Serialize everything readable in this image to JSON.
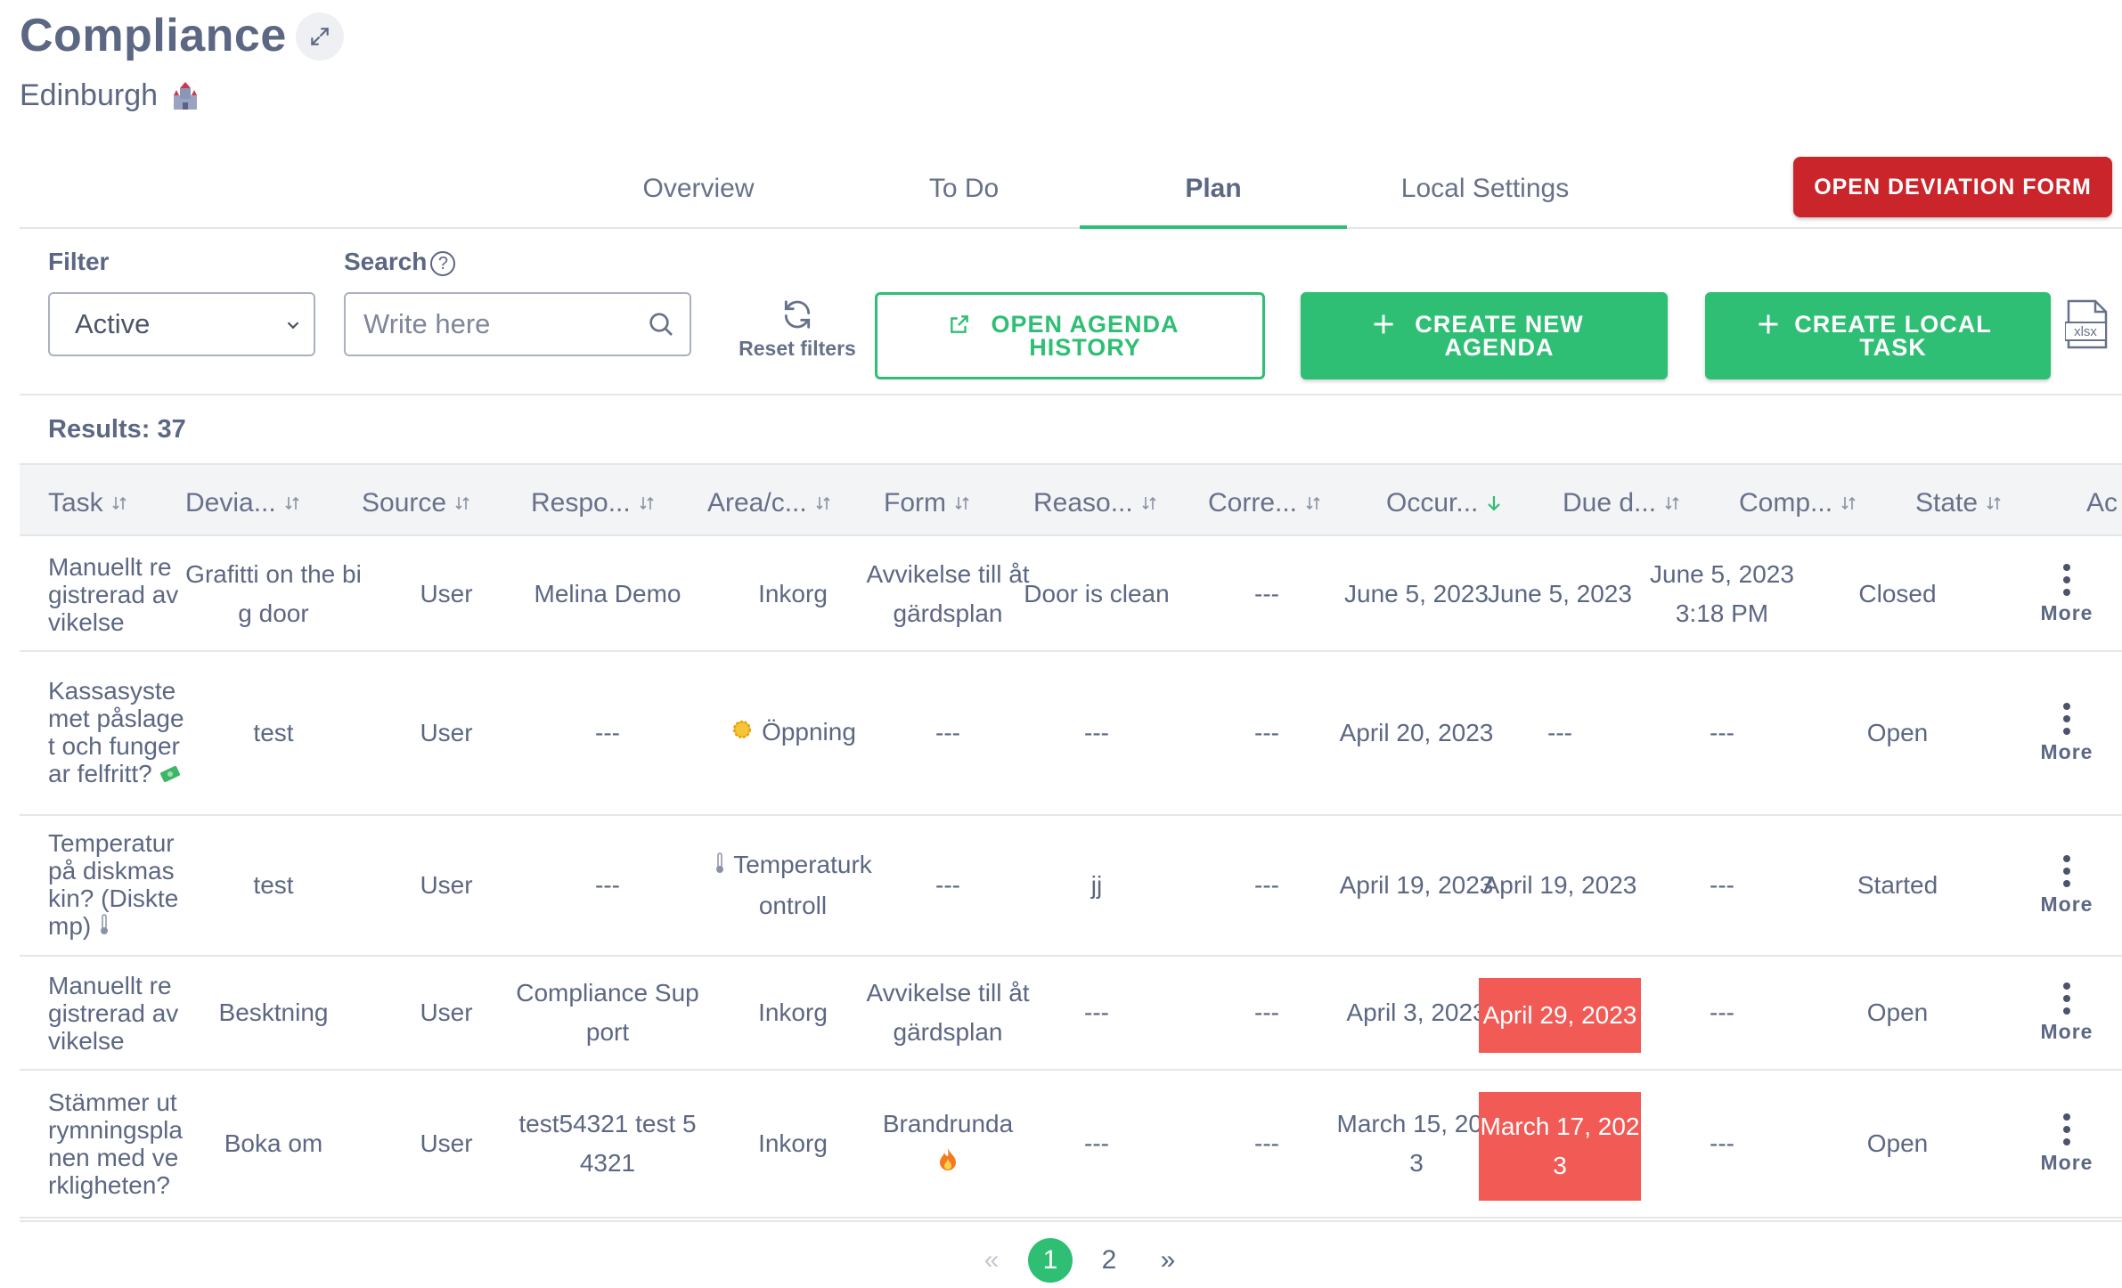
{
  "header": {
    "title": "Compliance",
    "subtitle": "Edinburgh"
  },
  "tabs": [
    {
      "label": "Overview",
      "active": false
    },
    {
      "label": "To Do",
      "active": false
    },
    {
      "label": "Plan",
      "active": true
    },
    {
      "label": "Local Settings",
      "active": false
    }
  ],
  "actions": {
    "deviation_form": "OPEN DEVIATION FORM",
    "agenda_history": "OPEN AGENDA HISTORY",
    "create_agenda": "CREATE NEW AGENDA",
    "create_local_task": "CREATE LOCAL TASK",
    "export_icon": "xlsx"
  },
  "filters": {
    "filter_label": "Filter",
    "filter_value": "Active",
    "search_label": "Search",
    "search_placeholder": "Write here",
    "reset_label": "Reset filters"
  },
  "results": "Results: 37",
  "columns": [
    "Task",
    "Devia...",
    "Source",
    "Respo...",
    "Area/c...",
    "Form",
    "Reaso...",
    "Corre...",
    "Occur...",
    "Due d...",
    "Comp...",
    "State",
    "Ac"
  ],
  "sorted_column": "Occur...",
  "rows": [
    {
      "task": "Manuellt registrerad avvikelse",
      "icon": "",
      "deviation": "Grafitti on the big door",
      "source": "User",
      "responsible": "Melina Demo",
      "area": "Inkorg",
      "area_icon": "",
      "form": "Avvikelse till åtgärdsplan",
      "form_icon": "",
      "reason": "Door is clean",
      "corrective": "---",
      "occurred": "June 5, 2023",
      "due": "June 5, 2023",
      "due_overdue": false,
      "completed": "June 5, 2023 3:18 PM",
      "state": "Closed",
      "more": "More"
    },
    {
      "task": "Kassasystemet påslaget och fungerar felfritt?",
      "icon": "money-icon",
      "deviation": "test",
      "source": "User",
      "responsible": "---",
      "area": "Öppning",
      "area_icon": "sun-icon",
      "form": "---",
      "form_icon": "",
      "reason": "---",
      "corrective": "---",
      "occurred": "April 20, 2023",
      "due": "---",
      "due_overdue": false,
      "completed": "---",
      "state": "Open",
      "more": "More"
    },
    {
      "task": "Temperatur på diskmaskin? (Disktemp)",
      "icon": "thermometer-icon",
      "deviation": "test",
      "source": "User",
      "responsible": "---",
      "area": "Temperaturkontroll",
      "area_icon": "thermometer-icon",
      "form": "---",
      "form_icon": "",
      "reason": "jj",
      "corrective": "---",
      "occurred": "April 19, 2023",
      "due": "April 19, 2023",
      "due_overdue": false,
      "completed": "---",
      "state": "Started",
      "more": "More"
    },
    {
      "task": "Manuellt registrerad avvikelse",
      "icon": "",
      "deviation": "Besktning",
      "source": "User",
      "responsible": "Compliance Support",
      "area": "Inkorg",
      "area_icon": "",
      "form": "Avvikelse till åtgärdsplan",
      "form_icon": "",
      "reason": "---",
      "corrective": "---",
      "occurred": "April 3, 2023",
      "due": "April 29, 2023",
      "due_overdue": true,
      "completed": "---",
      "state": "Open",
      "more": "More"
    },
    {
      "task": "Stämmer utrymningsplanen med verkligheten?",
      "icon": "",
      "deviation": "Boka om",
      "source": "User",
      "responsible": "test54321 test 54321",
      "area": "Inkorg",
      "area_icon": "",
      "form": "Brandrunda",
      "form_icon": "fire-icon",
      "reason": "---",
      "corrective": "---",
      "occurred": "March 15, 2023",
      "due": "March 17, 2023",
      "due_overdue": true,
      "completed": "---",
      "state": "Open",
      "more": "More"
    }
  ],
  "pagination": {
    "prev": "«",
    "pages": [
      "1",
      "2"
    ],
    "current": "1",
    "next": "»"
  },
  "colors": {
    "accent": "#2ebf74",
    "danger": "#c9252b",
    "overdue": "#f25a55",
    "text": "#5c6783"
  }
}
